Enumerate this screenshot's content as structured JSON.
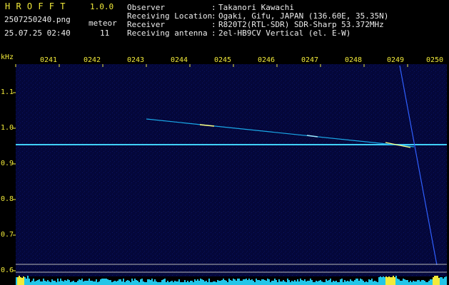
{
  "app": {
    "name": "H R O F F T",
    "version": "1.0.0"
  },
  "file": {
    "name": "2507250240.png",
    "datetime": "25.07.25 02:40"
  },
  "detection": {
    "label": "meteor",
    "count": "11"
  },
  "info": {
    "rows": [
      {
        "key": "Observer",
        "sep": ":",
        "value": "Takanori Kawachi"
      },
      {
        "key": "Receiving Location",
        "sep": ":",
        "value": "Ogaki, Gifu, JAPAN (136.60E, 35.35N)"
      },
      {
        "key": "Receiver",
        "sep": ":",
        "value": "R820T2(RTL-SDR) SDR-Sharp 53.372MHz"
      },
      {
        "key": "Receiving antenna",
        "sep": ":",
        "value": "2el-HB9CV Vertical (el. E-W)"
      }
    ]
  },
  "axes": {
    "y_unit": "kHz",
    "y_ticks": [
      "1.1",
      "1.0",
      "0.9",
      "0.8",
      "0.7",
      "0.6"
    ],
    "x_ticks": [
      "0241",
      "0242",
      "0243",
      "0244",
      "0245",
      "0246",
      "0247",
      "0248",
      "0249",
      "0250"
    ]
  },
  "colors": {
    "background": "#000000",
    "spectrum_bg": "#04073a",
    "label_yellow": "#f2ea3a",
    "signal_cyan": "#20c8ff",
    "signal_hot": "#ffff80",
    "histogram": "#22c6e8",
    "guide_line": "#b8b8b8"
  }
}
